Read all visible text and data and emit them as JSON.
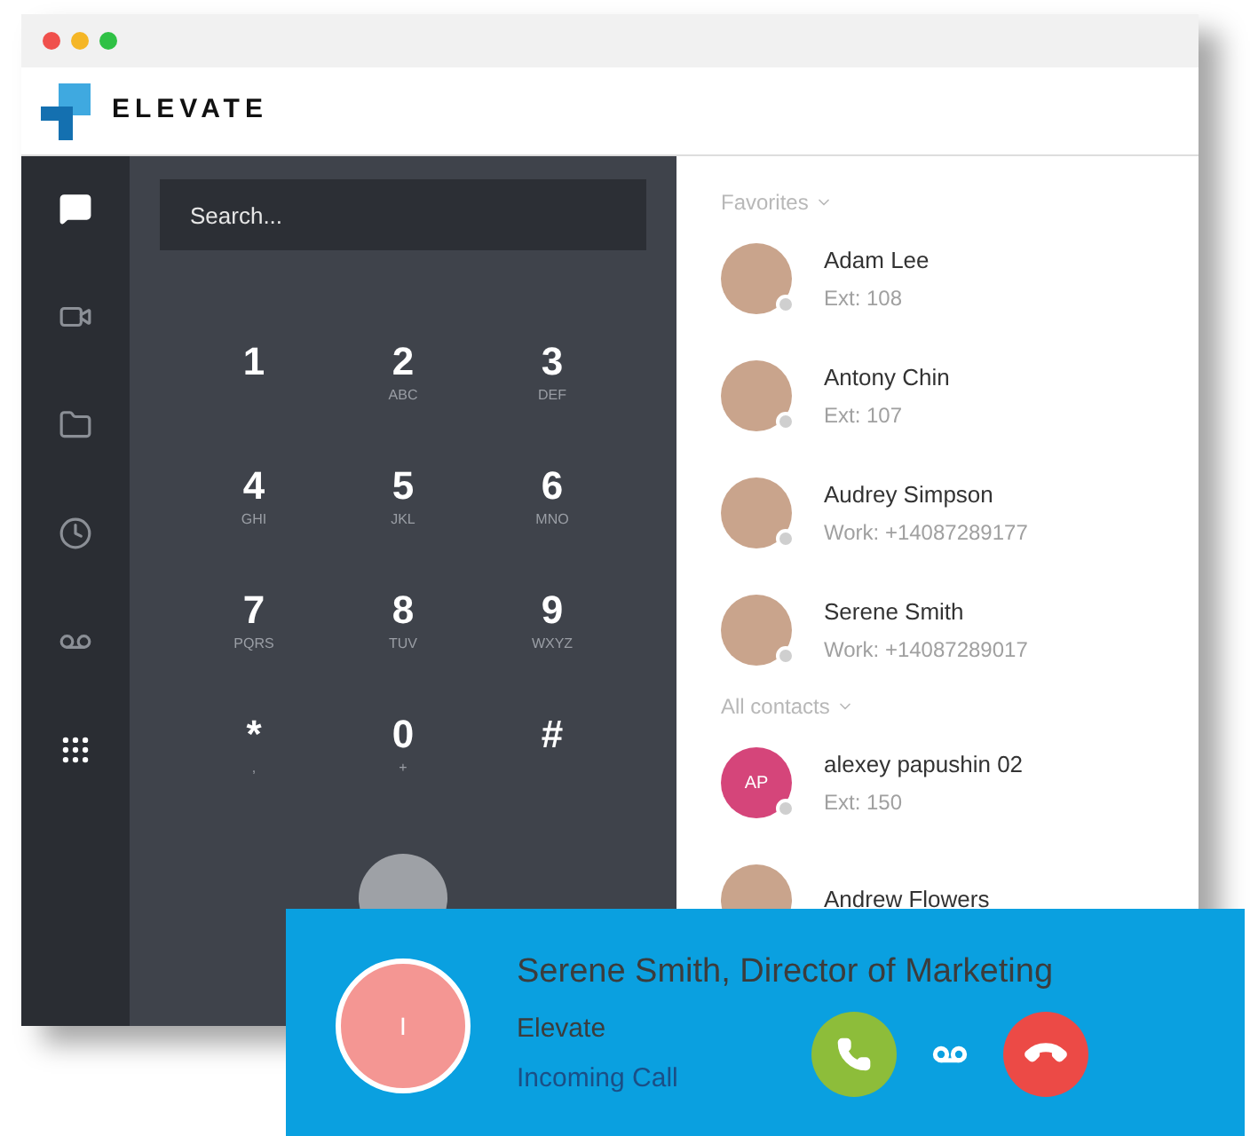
{
  "app": {
    "logo_text": "ELEVATE"
  },
  "sidebar": {
    "items": [
      {
        "selected": true
      },
      {
        "selected": false
      },
      {
        "selected": false
      },
      {
        "selected": false
      },
      {
        "selected": false
      },
      {
        "selected": true
      }
    ]
  },
  "dialer": {
    "search": {
      "placeholder": "Search..."
    },
    "keys": [
      {
        "digit": "1"
      },
      {
        "digit": "2",
        "letters": "ABC"
      },
      {
        "digit": "3",
        "letters": "DEF"
      },
      {
        "digit": "4",
        "letters": "GHI"
      },
      {
        "digit": "5",
        "letters": "JKL"
      },
      {
        "digit": "6",
        "letters": "MNO"
      },
      {
        "digit": "7",
        "letters": "PQRS"
      },
      {
        "digit": "8",
        "letters": "TUV"
      },
      {
        "digit": "9",
        "letters": "WXYZ"
      },
      {
        "digit": "*",
        "letters": ","
      },
      {
        "digit": "0",
        "letters": "+"
      },
      {
        "digit": "#"
      }
    ]
  },
  "contacts": {
    "sections": [
      {
        "title": "Favorites",
        "items": [
          {
            "name": "Adam Lee",
            "detail": "Ext: 108",
            "kind": "photo"
          },
          {
            "name": "Antony Chin",
            "detail": "Ext: 107",
            "kind": "photo"
          },
          {
            "name": "Audrey Simpson",
            "detail": "Work: +14087289177",
            "kind": "photo"
          },
          {
            "name": "Serene Smith",
            "detail": "Work: +14087289017",
            "kind": "photo"
          }
        ]
      },
      {
        "title": "All contacts",
        "items": [
          {
            "name": "alexey papushin 02",
            "detail": "Ext: 150",
            "kind": "initials",
            "initials": "AP",
            "color": "#d5457a"
          },
          {
            "name": "Andrew Flowers",
            "kind": "photo"
          }
        ]
      }
    ]
  },
  "notification": {
    "avatar_initial": "I",
    "caller": "Serene Smith, Director of Marketing",
    "company": "Elevate",
    "status": "Incoming Call",
    "actions": [
      {
        "kind": "answer"
      },
      {
        "kind": "voicemail"
      },
      {
        "kind": "decline"
      }
    ]
  }
}
